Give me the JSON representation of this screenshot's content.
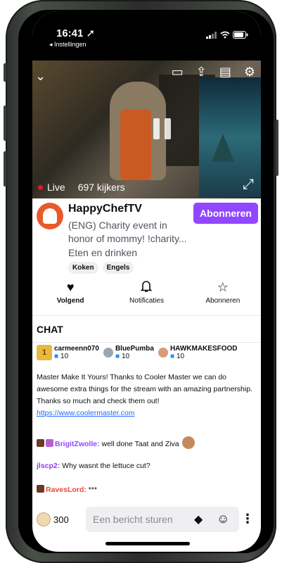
{
  "status_bar": {
    "time": "16:41",
    "back_label": "◂ Instellingen"
  },
  "video": {
    "live_label": "Live",
    "viewers": "697 kijkers"
  },
  "channel": {
    "name": "HappyChefTV",
    "title": "(ENG) Charity event in honor of mommy! !charity...",
    "category": "Eten en drinken",
    "tags": [
      "Koken",
      "Engels"
    ],
    "subscribe_button": "Abonneren"
  },
  "actions": [
    {
      "label": "Volgend",
      "icon": "heart-icon"
    },
    {
      "label": "Notificaties",
      "icon": "bell-icon"
    },
    {
      "label": "Abonneren",
      "icon": "star-icon"
    }
  ],
  "chat": {
    "header": "CHAT",
    "gifters": [
      {
        "name": "carmeenn070",
        "count": "10",
        "rank": "1"
      },
      {
        "name": "BluePumba",
        "count": "10"
      },
      {
        "name": "HAWKMAKESFOOD",
        "count": "10"
      }
    ],
    "announcement": "Master Make It Yours! Thanks to Cooler Master we can do awesome extra things for the stream with an amazing partnership. Thanks so much and check them out!",
    "announcement_link": "https://www.coolermaster.com",
    "messages": [
      {
        "user": "BrigitZwolle:",
        "text": " well done Taat and Ziva",
        "color": "#9147ff"
      },
      {
        "user": "jlscp2:",
        "text": " Why wasnt the lettuce cut?",
        "color": "#8a3ee8"
      },
      {
        "user": "RavesLord:",
        "text": " ***",
        "color": "#e84a3c"
      }
    ]
  },
  "bottom_bar": {
    "points": "300",
    "input_placeholder": "Een bericht sturen"
  },
  "colors": {
    "accent": "#9147ff",
    "live": "#e91916",
    "link": "#1f69ff"
  }
}
